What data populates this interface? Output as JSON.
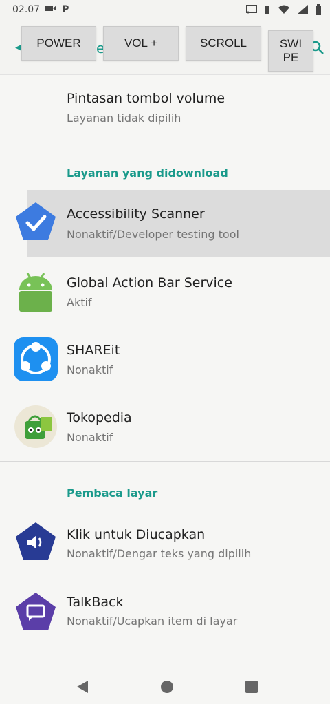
{
  "status_bar": {
    "time": "02.07",
    "notification_letter": "P"
  },
  "app_bar": {
    "title_fragment": "e"
  },
  "controls": {
    "power": "POWER",
    "vol_up": "VOL +",
    "scroll": "SCROLL",
    "swipe": "SWI\nPE"
  },
  "shortcut": {
    "title": "Pintasan tombol volume",
    "subtitle": "Layanan tidak dipilih"
  },
  "sections": {
    "downloaded": "Layanan yang didownload",
    "screen_reader": "Pembaca layar"
  },
  "downloaded_services": [
    {
      "name": "Accessibility Scanner",
      "status": "Nonaktif/Developer testing tool"
    },
    {
      "name": "Global Action Bar Service",
      "status": "Aktif"
    },
    {
      "name": "SHAREit",
      "status": "Nonaktif"
    },
    {
      "name": "Tokopedia",
      "status": "Nonaktif"
    }
  ],
  "screen_readers": [
    {
      "name": "Klik untuk Diucapkan",
      "status": "Nonaktif/Dengar teks yang dipilih"
    },
    {
      "name": "TalkBack",
      "status": "Nonaktif/Ucapkan item di layar"
    }
  ],
  "colors": {
    "accent": "#1a9a8b",
    "highlight": "#dcdcdc",
    "scanner_blue": "#3d7be0",
    "android_green": "#78c257",
    "shareit_blue": "#1e90f0",
    "reader_navy": "#283b94",
    "talkback_purple": "#5b3ea8"
  },
  "icons": [
    "back-icon",
    "search-icon",
    "accessibility-scanner-icon",
    "android-icon",
    "shareit-icon",
    "tokopedia-icon",
    "speaker-icon",
    "talkback-icon",
    "nav-back-icon",
    "nav-home-icon",
    "nav-recents-icon"
  ]
}
